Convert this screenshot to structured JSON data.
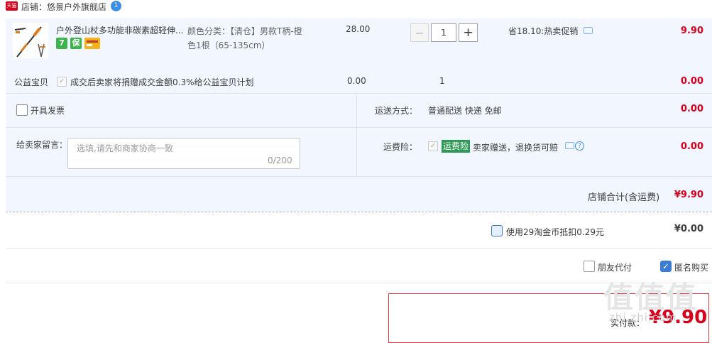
{
  "store": {
    "badge": "天猫",
    "label": "店铺：悠景户外旗舰店",
    "ww_icon": "1"
  },
  "item": {
    "title": "户外登山杖多功能非碳素超轻伸...",
    "badges": [
      {
        "text": "7",
        "color": "#3ab54a"
      },
      {
        "text": "保",
        "color": "#3ab54a"
      },
      {
        "text": "",
        "color": "#f6b21a"
      }
    ],
    "sku_line1": "颜色分类：【清仓】男款T柄-橙",
    "sku_line2": "色1根（65-135cm）",
    "unit_price": "28.00",
    "qty_minus": "−",
    "qty_value": "1",
    "qty_plus": "+",
    "promo": "省18.10:热卖促销",
    "subtotal": "9.90"
  },
  "charity": {
    "label": "公益宝贝",
    "check": "✓",
    "text": "成交后卖家将捐赠成交金额0.3%给公益宝贝计划",
    "price": "0.00",
    "qty": "1",
    "amount": "0.00"
  },
  "invoice": {
    "label": "开具发票"
  },
  "shipping": {
    "label": "运送方式：",
    "value": "普通配送 快递 免邮",
    "amount": "0.00"
  },
  "message": {
    "label": "给卖家留言：",
    "placeholder": "选填,请先和商家协商一致",
    "counter": "0/200"
  },
  "insurance": {
    "label": "运费险：",
    "check": "✓",
    "tag": "运费险",
    "text": "卖家赠送，退换货可赔",
    "q_icon": "?",
    "amount": "0.00"
  },
  "store_total": {
    "label": "店铺合计(含运费)",
    "value": "¥9.90"
  },
  "coins": {
    "label": "使用29淘金币抵扣0.29元",
    "value": "¥0.00"
  },
  "options": {
    "friend_pay": "朋友代付",
    "anonymous": "匿名购买",
    "anon_check": "✓"
  },
  "payment": {
    "label": "实付款：",
    "value": "¥9.90"
  },
  "watermark": {
    "big": "值值值",
    "small": "zhi.zhi.com"
  }
}
